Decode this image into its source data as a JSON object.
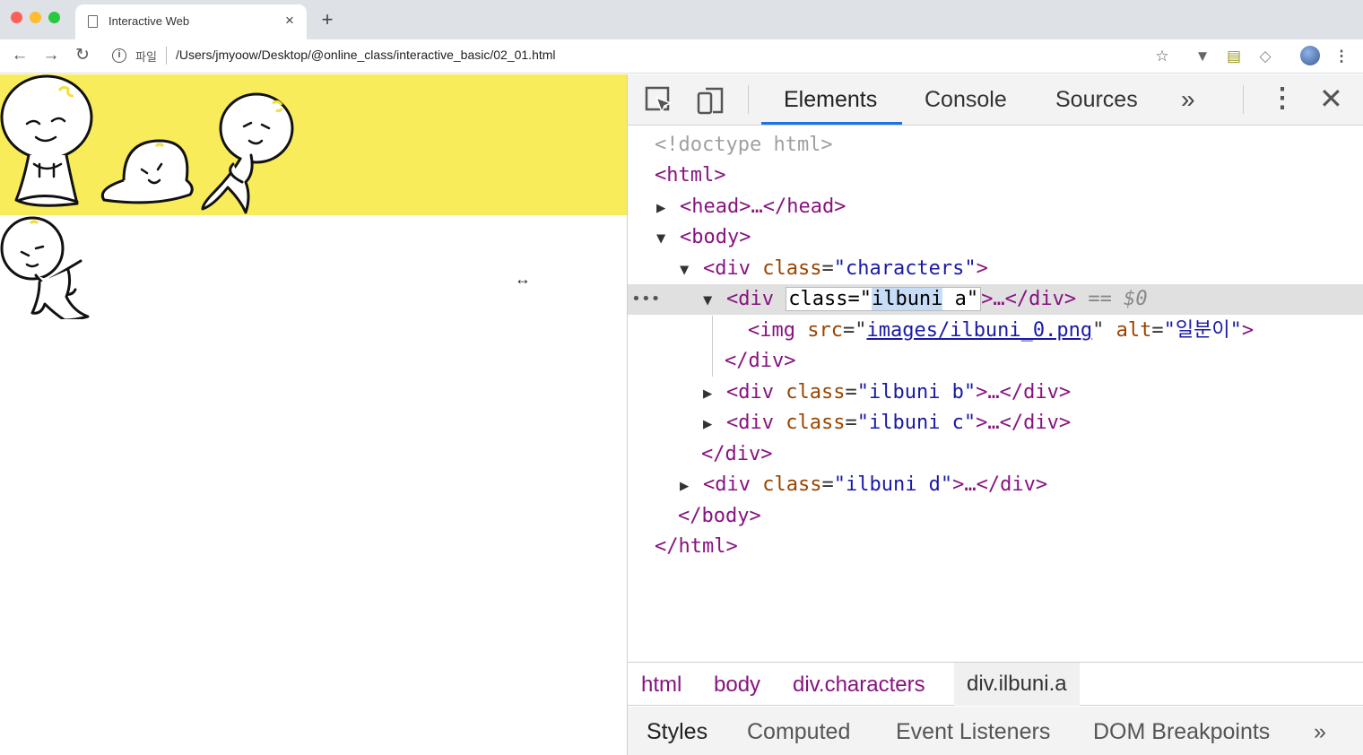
{
  "browser": {
    "tab_title": "Interactive Web",
    "tab_close": "×",
    "new_tab": "+",
    "scheme_label": "파일",
    "url": "/Users/jmyoow/Desktop/@online_class/interactive_basic/02_01.html",
    "icons": [
      "back-icon",
      "forward-icon",
      "reload-icon",
      "info-icon",
      "star-icon",
      "extension-icon",
      "avatar",
      "menu-icon"
    ]
  },
  "page": {
    "background_color": "#f9ec5a",
    "characters": [
      "ilbuni a",
      "ilbuni b",
      "ilbuni c",
      "ilbuni d"
    ]
  },
  "devtools": {
    "tabs": [
      "Elements",
      "Console",
      "Sources"
    ],
    "more": "»",
    "kebab": "⋮",
    "close": "✕",
    "dom": {
      "doctype": "<!doctype html>",
      "html_open": "<html>",
      "head": "<head>…</head>",
      "body_open": "<body>",
      "div_tag": "<div",
      "class_attr": "class",
      "characters_val": "\"characters\"",
      "selected_prefix": "class=\"",
      "selected_word": "ilbuni",
      "selected_rest": " a\"",
      "selected_tail": ">…</div>",
      "selected_marker": "== $0",
      "img_open": "<img",
      "src_attr": "src",
      "img_src": "images/ilbuni_0.png",
      "alt_attr": "alt",
      "alt_val": "\"일분이\"",
      "div_close": "</div>",
      "div_b_val": "\"ilbuni b\"",
      "div_c_val": "\"ilbuni c\"",
      "div_d_val": "\"ilbuni d\"",
      "collapsed_tail": ">…</div>",
      "body_close": "</body>",
      "html_close": "</html>",
      "ellipsis": "•••"
    },
    "breadcrumbs": [
      "html",
      "body",
      "div.characters",
      "div.ilbuni.a"
    ],
    "subtabs": [
      "Styles",
      "Computed",
      "Event Listeners",
      "DOM Breakpoints"
    ],
    "subtabs_more": "»"
  }
}
